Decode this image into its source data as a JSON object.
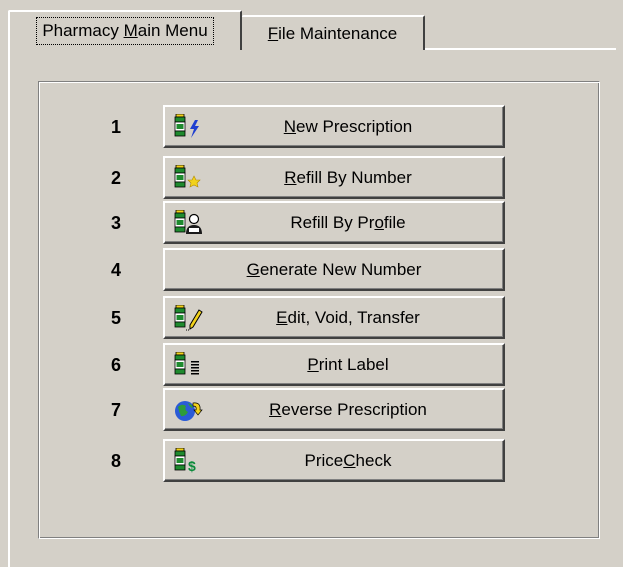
{
  "tabs": [
    {
      "label": "Pharmacy Main Menu",
      "mnemonic_index": 9,
      "active": true
    },
    {
      "label": "File Maintenance",
      "mnemonic_index": 0,
      "active": false
    }
  ],
  "menu": {
    "items": [
      {
        "number": "1",
        "label": "New Prescription",
        "mnemonic_index": 0,
        "icon": "bottle-lightning-icon"
      },
      {
        "number": "2",
        "label": "Refill By Number",
        "mnemonic_index": 0,
        "icon": "bottle-star-icon"
      },
      {
        "number": "3",
        "label": "Refill By Profile",
        "mnemonic_index": 12,
        "icon": "bottle-person-icon"
      },
      {
        "number": "4",
        "label": "Generate New Number",
        "mnemonic_index": 0,
        "icon": ""
      },
      {
        "number": "5",
        "label": "Edit, Void, Transfer",
        "mnemonic_index": 0,
        "icon": "bottle-pencil-icon"
      },
      {
        "number": "6",
        "label": "Print Label",
        "mnemonic_index": 0,
        "icon": "bottle-lines-icon"
      },
      {
        "number": "7",
        "label": "Reverse Prescription",
        "mnemonic_index": 0,
        "icon": "globe-arrow-icon"
      },
      {
        "number": "8",
        "label": "Price Check",
        "mnemonic_index": 6,
        "icon": "bottle-dollar-icon"
      }
    ]
  },
  "colors": {
    "face": "#d4d0c8",
    "highlight": "#ffffff",
    "shadow": "#808080",
    "dark_shadow": "#404040",
    "bottle_green": "#1e8a2e",
    "bottle_yellow": "#f2d21b",
    "lightning_blue": "#1f3fd0",
    "dollar_green": "#0a8a3a"
  }
}
